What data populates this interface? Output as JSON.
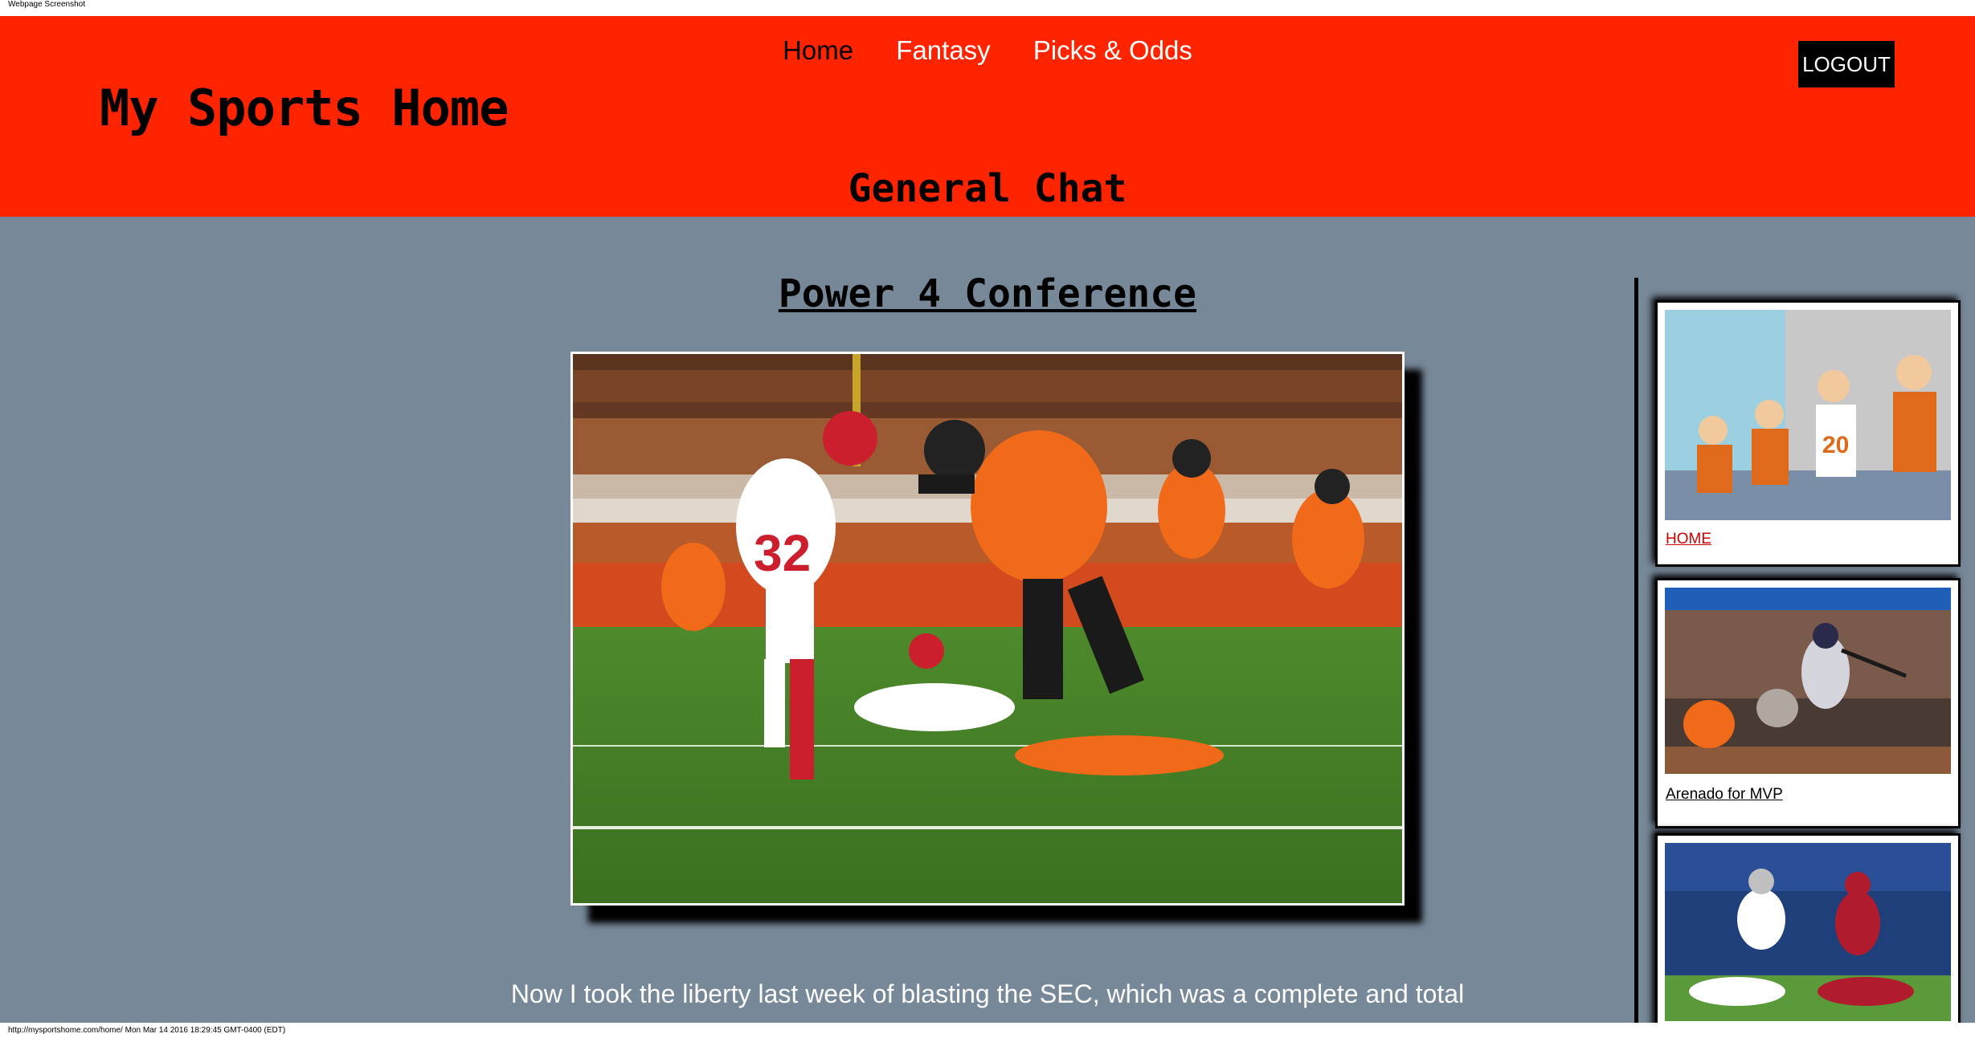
{
  "print": {
    "header": "Webpage Screenshot",
    "footer": "http://mysportshome.com/home/ Mon Mar 14 2016 18:29:45 GMT-0400 (EDT)"
  },
  "nav": {
    "items": [
      {
        "label": "Home",
        "active": true
      },
      {
        "label": "Fantasy",
        "active": false
      },
      {
        "label": "Picks & Odds",
        "active": false
      }
    ]
  },
  "header": {
    "site_title": "My Sports Home",
    "logout_label": "LOGOUT",
    "section_title": "General Chat"
  },
  "article": {
    "title": "Power 4 Conference",
    "body_text": "Now I took the liberty last week of blasting the SEC, which was a complete and total"
  },
  "sidebar": {
    "cards": [
      {
        "link_label": "HOME",
        "link_color": "#cc0000"
      },
      {
        "link_label": "Arenado for MVP",
        "link_color": "#000000"
      },
      {
        "link_label": "",
        "link_color": "#000000"
      }
    ]
  },
  "colors": {
    "header_bg": "#ff2400",
    "page_bg": "#778899",
    "logout_bg": "#000000"
  }
}
